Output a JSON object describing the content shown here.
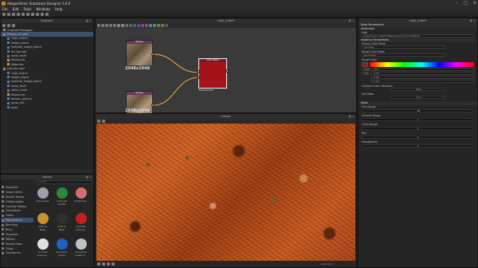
{
  "window": {
    "title": "Allegorithmic Substance Designer 5.6.0"
  },
  "menu": [
    "File",
    "Edit",
    "Tools",
    "Windows",
    "Help"
  ],
  "explorer": {
    "title": "Explorer",
    "items": [
      {
        "label": "Unsaved Packages",
        "depth": 0,
        "icon": "package-icon"
      },
      {
        "label": "Ribbon_01.sbs*",
        "depth": 0,
        "icon": "package-icon",
        "selected": true
      },
      {
        "label": "color_match",
        "depth": 1,
        "icon": "graph-icon"
      },
      {
        "label": "height_blend",
        "depth": 1,
        "icon": "graph-icon"
      },
      {
        "label": "material_height_blend",
        "depth": 1,
        "icon": "graph-icon"
      },
      {
        "label": "AO_Normal",
        "depth": 1,
        "icon": "graph-icon"
      },
      {
        "label": "mask_level",
        "depth": 1,
        "icon": "graph-icon"
      },
      {
        "label": "Resources",
        "depth": 1,
        "icon": "folder-icon"
      },
      {
        "label": "Materials",
        "depth": 1,
        "icon": "folder-icon"
      },
      {
        "label": "textures.sbs*",
        "depth": 0,
        "icon": "package-icon"
      },
      {
        "label": "color_match",
        "depth": 1,
        "icon": "graph-icon"
      },
      {
        "label": "height_blend",
        "depth": 1,
        "icon": "graph-icon"
      },
      {
        "label": "material_height_blend",
        "depth": 1,
        "icon": "graph-icon"
      },
      {
        "label": "noise_level",
        "depth": 1,
        "icon": "graph-icon"
      },
      {
        "label": "stone_cover",
        "depth": 1,
        "icon": "graph-icon"
      },
      {
        "label": "Resources",
        "depth": 1,
        "icon": "folder-icon"
      },
      {
        "label": "tarmac_ground",
        "depth": 1,
        "icon": "graph-icon"
      },
      {
        "label": "grass_dirt",
        "depth": 1,
        "icon": "graph-icon"
      },
      {
        "label": "basic",
        "depth": 1,
        "icon": "graph-icon"
      }
    ]
  },
  "graph": {
    "title": "color_match",
    "node1": {
      "head": "Bitmap",
      "label": "2048x2048"
    },
    "node2": {
      "head": "Bitmap",
      "label": "2048x2048"
    },
    "node3": {
      "head": "Color Match",
      "label": "2048x2048"
    }
  },
  "output": {
    "title": "Output"
  },
  "library": {
    "title": "Library",
    "search_placeholder": "Search",
    "categories": [
      "Favorites",
      "Graph Items",
      "Atomic Nodes",
      "FxMap Nodes",
      "Function Nodes",
      "Generators",
      "Filters",
      "Adjustments",
      "Blending",
      "Blurs",
      "Channels",
      "Effects",
      "Normal Map",
      "Tiling",
      "Transforms"
    ],
    "selected_category": "Adjustments",
    "items": [
      {
        "label": "Auto Levels",
        "color": "#9aa0a8"
      },
      {
        "label": "Channels Shuffle",
        "color": "#2d8a3a"
      },
      {
        "label": "Chrominan...",
        "color": "#d07070"
      },
      {
        "label": "Color to Mask",
        "color": "#c89030"
      },
      {
        "label": "Color to Mask",
        "color": "#303030"
      },
      {
        "label": "Contrast Luminos...",
        "color": "#c02020"
      },
      {
        "label": "Contrast Luminos...",
        "color": "#e0e0e0"
      },
      {
        "label": "Convert to Linear",
        "color": "#2060c0"
      },
      {
        "label": "Convert to Linear S...",
        "color": "#c0c0c0"
      }
    ]
  },
  "viewport_status": {
    "zoom": "111.11 %",
    "res": "2048 x 2048 (RGBA, 8bpc)"
  },
  "params": {
    "title": "color_match",
    "sections": {
      "base": "Base Parameters",
      "attributes": "Attributes",
      "instance": "Instance Parameters"
    },
    "path_label": "Path",
    "path_value": "pkg:///color_match?dependency=1271393876",
    "source_color_mode_label": "Source Color Mode",
    "source_color_mode": "Average",
    "target_color_mode_label": "Target Color Mode",
    "target_color_mode": "Parameter",
    "target_color_label": "Target Color",
    "rgb_label": "RGB",
    "hsl_label": "HSL",
    "rgb_value": "255",
    "hsl_value": "1.00",
    "hue_value": "0.00",
    "sat_value": "1.00",
    "combine_label": "Combine Color Variation",
    "combine_value": "False",
    "use_mask_label": "Use Mask",
    "use_mask_value": "True",
    "mask_section": "Mask",
    "hue_range_label": "Hue Range",
    "hue_range_value": "30",
    "chroma_range_label": "Chroma Range",
    "chroma_range_value": "1",
    "luma_range_label": "Luma Range",
    "luma_range_value": "1",
    "blur_label": "Blur",
    "blur_value": "1",
    "smoothness_label": "Smoothness",
    "smoothness_value": "1"
  },
  "colors": {
    "node_red": "#a3131a",
    "port": "#f0b030",
    "accent": "#3d4f6b"
  }
}
